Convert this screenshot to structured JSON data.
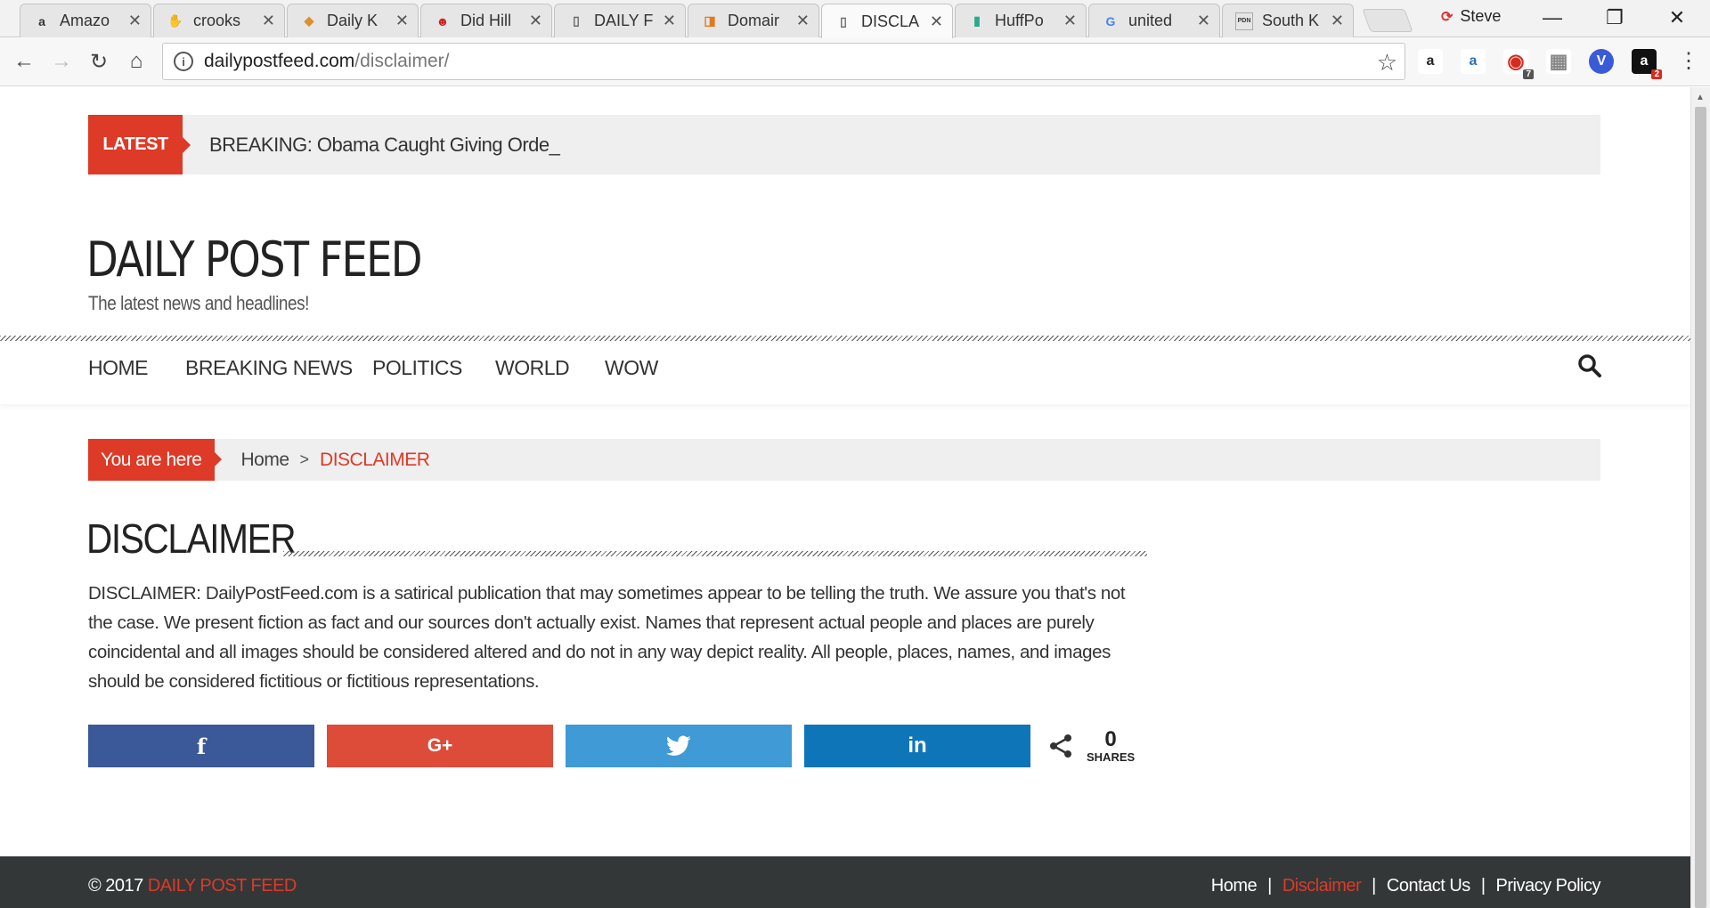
{
  "browser": {
    "tabs": [
      {
        "title": "Amazo",
        "icon": "amazon-icon",
        "favicon_text": "a",
        "favicon_color": "#222222"
      },
      {
        "title": "crooks",
        "icon": "hand-icon",
        "favicon_text": "✋",
        "favicon_color": "#555555"
      },
      {
        "title": "Daily K",
        "icon": "daily-kos-icon",
        "favicon_text": "◆",
        "favicon_color": "#e0902a"
      },
      {
        "title": "Did Hill",
        "icon": "mask-icon",
        "favicon_text": "☻",
        "favicon_color": "#cc2222"
      },
      {
        "title": "DAILY F",
        "icon": "page-icon",
        "favicon_text": "▯",
        "favicon_color": "#666666"
      },
      {
        "title": "Domair",
        "icon": "domain-icon",
        "favicon_text": "◨",
        "favicon_color": "#e07a1f"
      },
      {
        "title": "DISCLA",
        "icon": "page-icon",
        "favicon_text": "▯",
        "favicon_color": "#666666",
        "active": true
      },
      {
        "title": "HuffPo",
        "icon": "huffpost-icon",
        "favicon_text": "▮",
        "favicon_color": "#2aaa8a"
      },
      {
        "title": "united",
        "icon": "google-icon",
        "favicon_text": "G",
        "favicon_color": "#4285f4"
      },
      {
        "title": "South K",
        "icon": "pdn-icon",
        "favicon_text": "PDN",
        "favicon_color": "#333333"
      }
    ],
    "profile_name": "Steve",
    "url_host": "dailypostfeed.com",
    "url_path": "/disclaimer/",
    "extensions": [
      {
        "icon": "amazon-icon",
        "text": "a",
        "bg": "#ffffff",
        "fg": "#222222"
      },
      {
        "icon": "amazon-assistant-icon",
        "text": "a",
        "bg": "#ffffff",
        "fg": "#2c6fb5"
      },
      {
        "icon": "opera-icon",
        "text": "◉",
        "bg": "#ffffff",
        "fg": "#d62b1f",
        "badge": "7",
        "badge_bg": "#555555"
      },
      {
        "icon": "screen-icon",
        "text": "▦",
        "bg": "#ffffff",
        "fg": "#888888"
      },
      {
        "icon": "v-icon",
        "text": "V",
        "bg": "#3a5bd9",
        "fg": "#ffffff"
      },
      {
        "icon": "amazon-dark-icon",
        "text": "a",
        "bg": "#111111",
        "fg": "#ffffff",
        "badge": "2",
        "badge_bg": "#d62b1f"
      }
    ]
  },
  "site": {
    "ticker_label": "LATEST",
    "ticker_headline": "BREAKING: Obama Caught Giving Orde_",
    "title": "DAILY POST FEED",
    "tagline": "The latest news and headlines!",
    "nav": [
      "HOME",
      "BREAKING NEWS",
      "POLITICS",
      "WORLD",
      "WOW"
    ],
    "breadcrumb_label": "You are here",
    "breadcrumb_home": "Home",
    "breadcrumb_sep": ">",
    "breadcrumb_current": "DISCLAIMER",
    "heading": "DISCLAIMER",
    "body": "DISCLAIMER: DailyPostFeed.com is a satirical publication that may sometimes appear to be telling the truth. We assure you that's not the case. We present fiction as fact and our sources don't actually exist. Names that represent actual people and places are purely coincidental and all images should be considered altered and do not in any way depict reality. All people, places, names, and images should be considered fictitious or fictitious representations.",
    "share_buttons": [
      {
        "name": "facebook",
        "label": "f",
        "color": "#3b5998"
      },
      {
        "name": "google-plus",
        "label": "G+",
        "color": "#dd4b39"
      },
      {
        "name": "twitter",
        "label": "🐦",
        "color": "#3f9ad6"
      },
      {
        "name": "linkedin",
        "label": "in",
        "color": "#0e76b8"
      }
    ],
    "share_count": "0",
    "share_label": "SHARES",
    "footer_year": "© 2017",
    "footer_brand": "DAILY POST FEED",
    "footer_links": [
      "Home",
      "Disclaimer",
      "Contact Us",
      "Privacy Policy"
    ],
    "footer_sep": "|",
    "accent_color": "#dd3a27",
    "footer_bg": "#333738"
  }
}
